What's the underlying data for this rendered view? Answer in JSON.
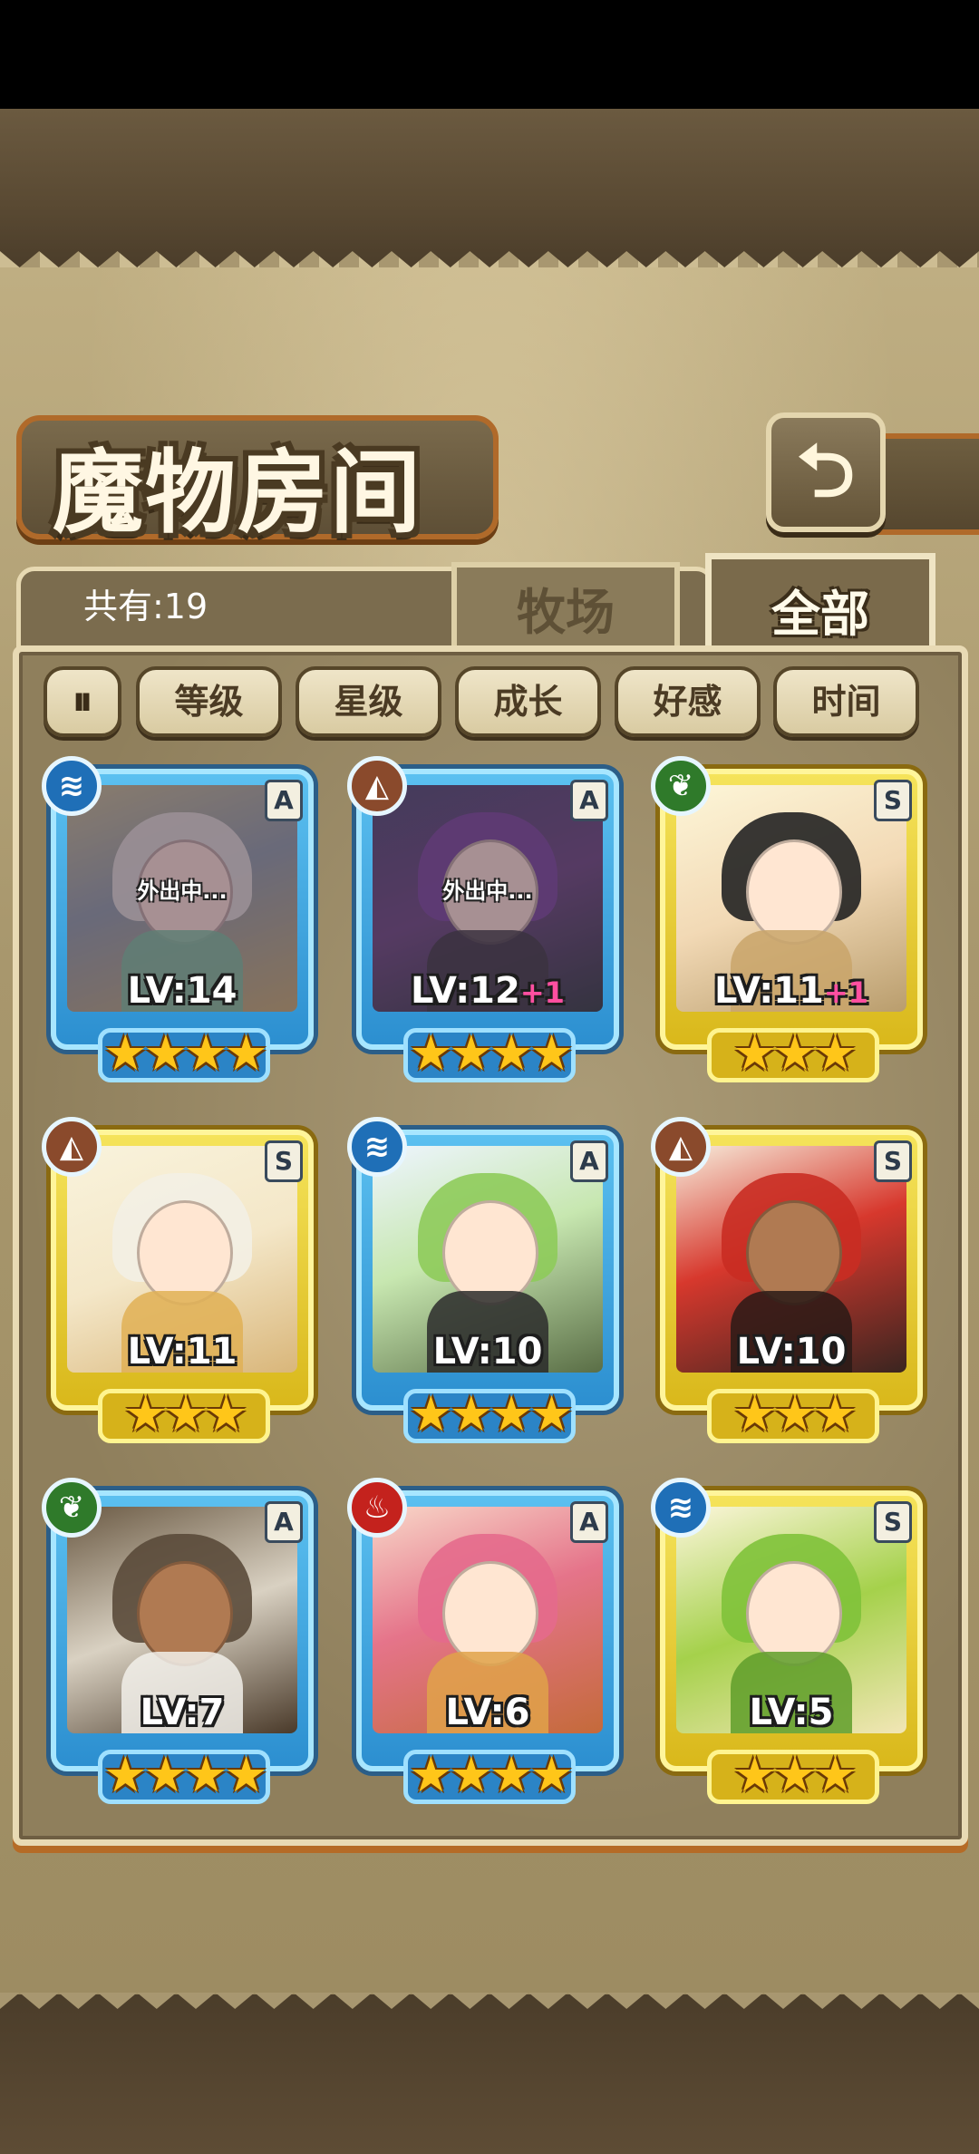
{
  "header": {
    "title": "魔物房间",
    "back_icon": "return-arrow-icon",
    "back_glyph": "⮌"
  },
  "summary": {
    "count_label": "共有:19"
  },
  "tabs": [
    {
      "label": "牧场",
      "selected": false
    },
    {
      "label": "全部",
      "selected": true
    }
  ],
  "filters": {
    "sort_glyph": "⏸",
    "sort_icon": "sort-order-icon",
    "items": [
      "等级",
      "星级",
      "成长",
      "好感",
      "时间"
    ]
  },
  "monsters": [
    {
      "level": "LV:14",
      "plus": "",
      "rank": "A",
      "element": "water",
      "element_glyph": "≋",
      "stars": "★★★★",
      "status": "外出中...",
      "frame": "blue"
    },
    {
      "level": "LV:12",
      "plus": "+1",
      "rank": "A",
      "element": "earth",
      "element_glyph": "◭",
      "stars": "★★★★",
      "status": "外出中...",
      "frame": "blue"
    },
    {
      "level": "LV:11",
      "plus": "+1",
      "rank": "S",
      "element": "wind",
      "element_glyph": "❦",
      "stars": "★★★",
      "status": "",
      "frame": "gold"
    },
    {
      "level": "LV:11",
      "plus": "",
      "rank": "S",
      "element": "earth",
      "element_glyph": "◭",
      "stars": "★★★",
      "status": "",
      "frame": "gold"
    },
    {
      "level": "LV:10",
      "plus": "",
      "rank": "A",
      "element": "water",
      "element_glyph": "≋",
      "stars": "★★★★",
      "status": "",
      "frame": "blue"
    },
    {
      "level": "LV:10",
      "plus": "",
      "rank": "S",
      "element": "earth",
      "element_glyph": "◭",
      "stars": "★★★",
      "status": "",
      "frame": "gold"
    },
    {
      "level": "LV:7",
      "plus": "",
      "rank": "A",
      "element": "wind",
      "element_glyph": "❦",
      "stars": "★★★★",
      "status": "",
      "frame": "blue"
    },
    {
      "level": "LV:6",
      "plus": "",
      "rank": "A",
      "element": "fire",
      "element_glyph": "♨",
      "stars": "★★★★",
      "status": "",
      "frame": "blue"
    },
    {
      "level": "LV:5",
      "plus": "",
      "rank": "S",
      "element": "water",
      "element_glyph": "≋",
      "stars": "★★★",
      "status": "",
      "frame": "gold"
    }
  ]
}
